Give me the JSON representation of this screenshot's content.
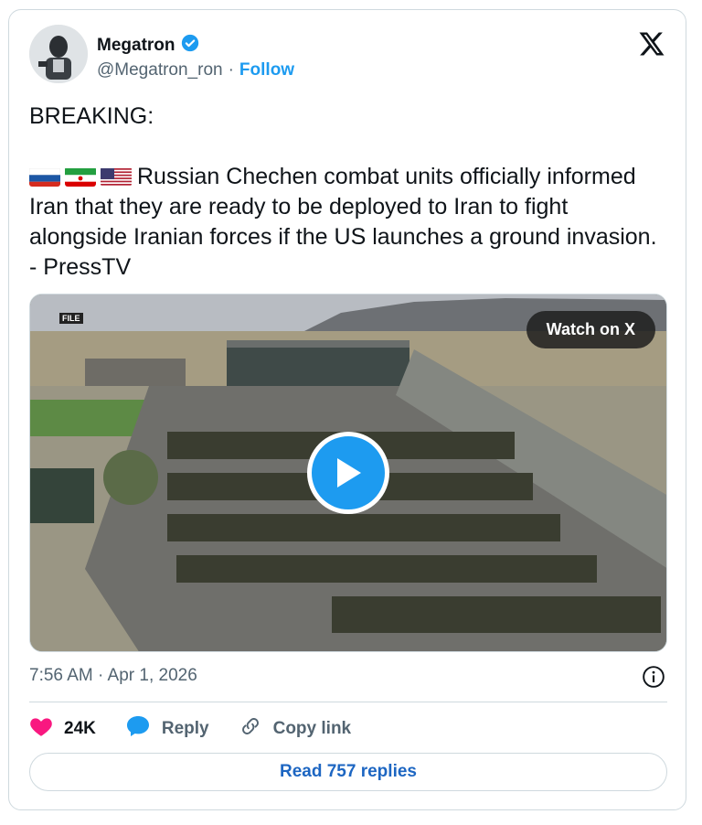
{
  "author": {
    "name": "Megatron",
    "handle": "@Megatron_ron",
    "separator": "·",
    "follow_label": "Follow"
  },
  "tweet": {
    "headline": "BREAKING:",
    "flags": [
      "russia-flag",
      "iran-flag",
      "usa-flag"
    ],
    "body": "Russian Chechen combat units officially informed Iran that they are ready to be deployed to Iran to fight alongside Iranian forces if the US launches a ground invasion. - PressTV"
  },
  "media": {
    "file_tag": "FILE",
    "watch_label": "Watch on X"
  },
  "timestamp": "7:56 AM · Apr 1, 2026",
  "actions": {
    "likes": "24K",
    "reply_label": "Reply",
    "copy_link_label": "Copy link"
  },
  "read_replies_label": "Read 757 replies",
  "colors": {
    "accent": "#1d9bf0",
    "like": "#f91880",
    "link": "#1d66c2"
  }
}
